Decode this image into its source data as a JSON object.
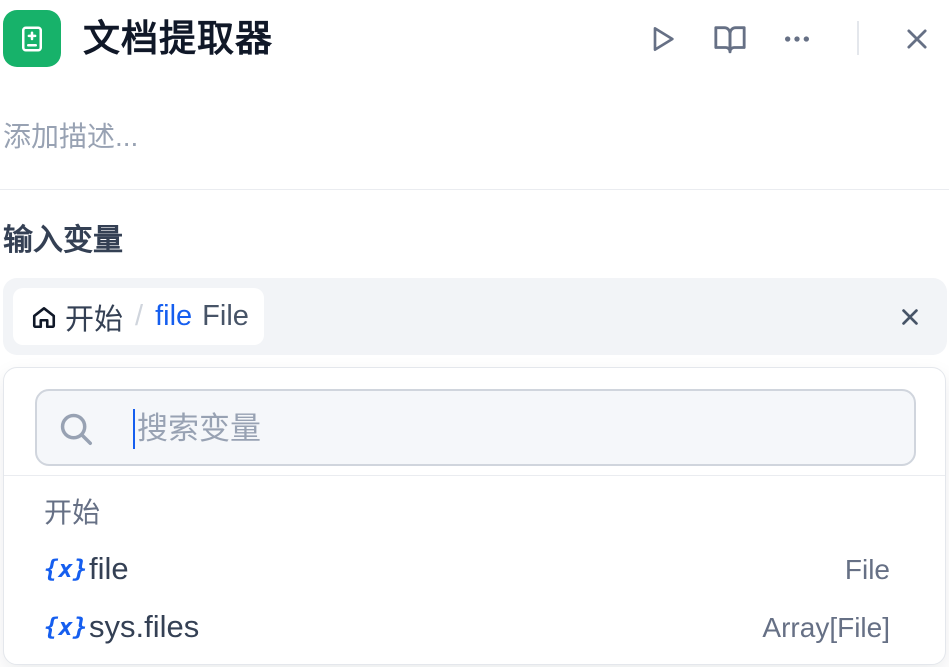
{
  "header": {
    "title": "文档提取器",
    "icons": {
      "app": "document-extractor-icon",
      "run": "play-icon",
      "docs": "book-open-icon",
      "more": "more-horizontal-icon",
      "close": "close-icon"
    }
  },
  "description": {
    "placeholder": "添加描述..."
  },
  "input_section": {
    "title": "输入变量",
    "selected": {
      "node": "开始",
      "separator": "/",
      "name": "file",
      "type": "File"
    }
  },
  "dropdown": {
    "search_placeholder": "搜索变量",
    "group": "开始",
    "items": [
      {
        "icon": "{x}",
        "name": "file",
        "type": "File"
      },
      {
        "icon": "{x}",
        "name": "sys.files",
        "type": "Array[File]"
      }
    ]
  },
  "colors": {
    "brand": "#17b26a",
    "accent": "#155eef",
    "muted": "#98a2b3"
  }
}
